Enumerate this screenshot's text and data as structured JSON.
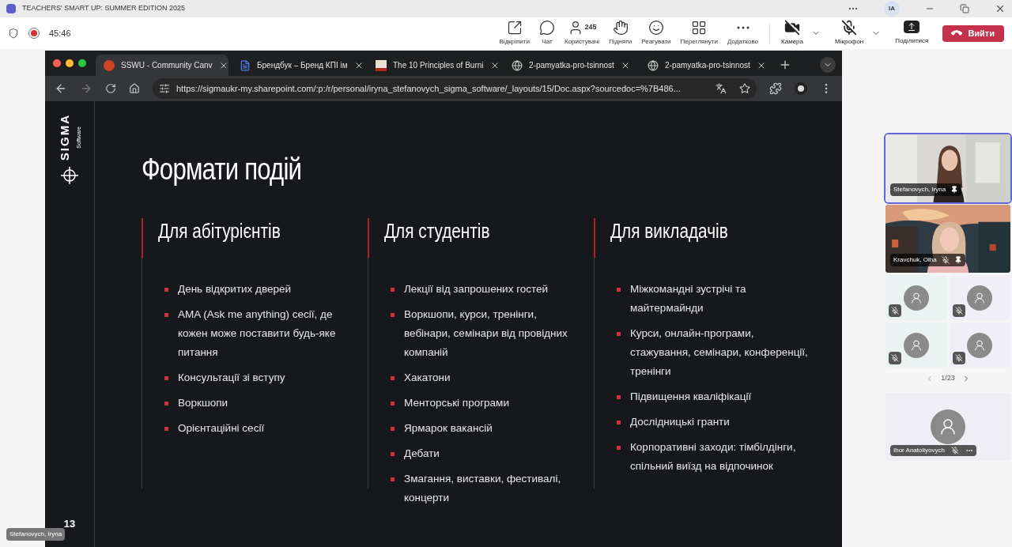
{
  "title_bar": {
    "title": "TEACHERS' SMART UP: SUMMER EDITION 2025",
    "account_initials": "IA"
  },
  "meeting_bar": {
    "timer": "45:46",
    "recording": true,
    "actions": [
      {
        "kind": "popout",
        "label": "Відкріпити"
      },
      {
        "kind": "chat",
        "label": "Чат"
      },
      {
        "kind": "people",
        "label": "Користувачі",
        "count": "245"
      },
      {
        "kind": "hand",
        "label": "Підняти"
      },
      {
        "kind": "react",
        "label": "Реагувати"
      },
      {
        "kind": "view",
        "label": "Переглянути"
      },
      {
        "kind": "more",
        "label": "Додатково"
      }
    ],
    "camera": {
      "label": "Камера",
      "on": false
    },
    "mic": {
      "label": "Мікрофон",
      "on": false
    },
    "share": {
      "label": "Поділитися"
    },
    "leave": {
      "label": "Вийти"
    }
  },
  "browser": {
    "tabs": [
      {
        "kind": "slides",
        "title": "SSWU - Community Canv",
        "selected": true
      },
      {
        "kind": "doc",
        "title": "Брендбук – Бренд КПІ ім",
        "selected": false
      },
      {
        "title": "The 10 Principles of Burni",
        "selected": false
      },
      {
        "kind": "web",
        "title": "2-pamyatka-pro-tsinnost",
        "selected": false
      },
      {
        "kind": "web",
        "title": "2-pamyatka-pro-tsinnost",
        "selected": false
      }
    ],
    "url": "https://sigmaukr-my.sharepoint.com/:p:/r/personal/iryna_stefanovych_sigma_software/_layouts/15/Doc.aspx?sourcedoc=%7B486..."
  },
  "slide": {
    "logo": "SIGMA",
    "logo_sub": "Software",
    "title": "Формати подій",
    "page_number": "13",
    "columns": [
      {
        "heading": "Для абітурієнтів",
        "items": [
          "День відкритих дверей",
          "AMA (Ask me anything) сесії, де кожен може поставити будь-яке питання",
          "Консультації зі вступу",
          "Воркшопи",
          "Орієнтаційні сесії"
        ]
      },
      {
        "heading": "Для студентів",
        "items": [
          "Лекції від запрошених гостей",
          "Воркшопи, курси, тренінги, вебінари, семінари від провідних компаній",
          "Хакатони",
          "Менторські програми",
          "Ярмарок вакансій",
          "Дебати",
          "Змагання, виставки, фестивалі, концерти"
        ]
      },
      {
        "heading": "Для викладачів",
        "items": [
          "Міжкомандні зустрічі та майтермайнди",
          "Курси, онлайн-програми, стажування, семінари, конференції, тренінги",
          "Підвищення кваліфікації",
          "Дослідницькі гранти",
          "Корпоративні заходи: тімбілдінги, спільний виїзд на відпочинок"
        ]
      }
    ]
  },
  "presenter_label": "Stefanovych, Iryna",
  "participants": [
    {
      "name": "Stefanovych, Iryna",
      "muted": false,
      "pinned": true,
      "selected": true
    },
    {
      "name": "Kravchuk, Olha",
      "muted": true,
      "pinned": true,
      "selected": false
    }
  ],
  "grid": [
    {
      "muted": true
    },
    {
      "muted": true
    },
    {
      "muted": true
    },
    {
      "muted": true
    }
  ],
  "pager": "1/23",
  "bottom_participant": {
    "name": "Ihor Anatoliyovych",
    "muted": true
  }
}
